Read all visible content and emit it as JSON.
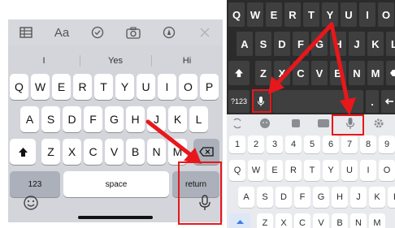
{
  "ios": {
    "toolbar": [
      "table-icon",
      "Aa",
      "checklist-icon",
      "camera-icon",
      "markup-icon",
      "close-icon"
    ],
    "toolbar_text": "Aa",
    "suggestions": [
      "I",
      "Yes",
      "Hi"
    ],
    "rows": {
      "row1": [
        "Q",
        "W",
        "E",
        "R",
        "T",
        "Y",
        "U",
        "I",
        "O",
        "P"
      ],
      "row2": [
        "A",
        "S",
        "D",
        "F",
        "G",
        "H",
        "J",
        "K",
        "L"
      ],
      "row3": [
        "Z",
        "X",
        "C",
        "V",
        "B",
        "N",
        "M"
      ]
    },
    "numbers_label": "123",
    "space_label": "space",
    "return_label": "return"
  },
  "android_dark": {
    "rows": {
      "row1": [
        "Q",
        "W",
        "E",
        "R",
        "T",
        "Y",
        "U",
        "I",
        "O"
      ],
      "row2": [
        "A",
        "S",
        "D",
        "F",
        "G",
        "H",
        "J",
        "K",
        "L"
      ],
      "row3": [
        "Z",
        "X",
        "C",
        "V",
        "B",
        "N",
        "M"
      ]
    },
    "symbols_label": "?123",
    "period_label": "."
  },
  "android_light": {
    "numbers": [
      "1",
      "2",
      "3",
      "4",
      "5",
      "6",
      "7",
      "8",
      "9"
    ],
    "rows": {
      "row1": [
        "Q",
        "W",
        "E",
        "R",
        "T",
        "Y",
        "U",
        "I",
        "O"
      ],
      "row2": [
        "A",
        "S",
        "D",
        "F",
        "G",
        "H",
        "J",
        "K",
        "L"
      ],
      "row3": [
        "Z",
        "X",
        "C",
        "V",
        "B",
        "N",
        "M"
      ]
    }
  },
  "colors": {
    "highlight": "#e8171b",
    "ios_background": "#d3d5db",
    "android_dark_background": "#2b2b2b",
    "android_light_background": "#e8eaed"
  }
}
